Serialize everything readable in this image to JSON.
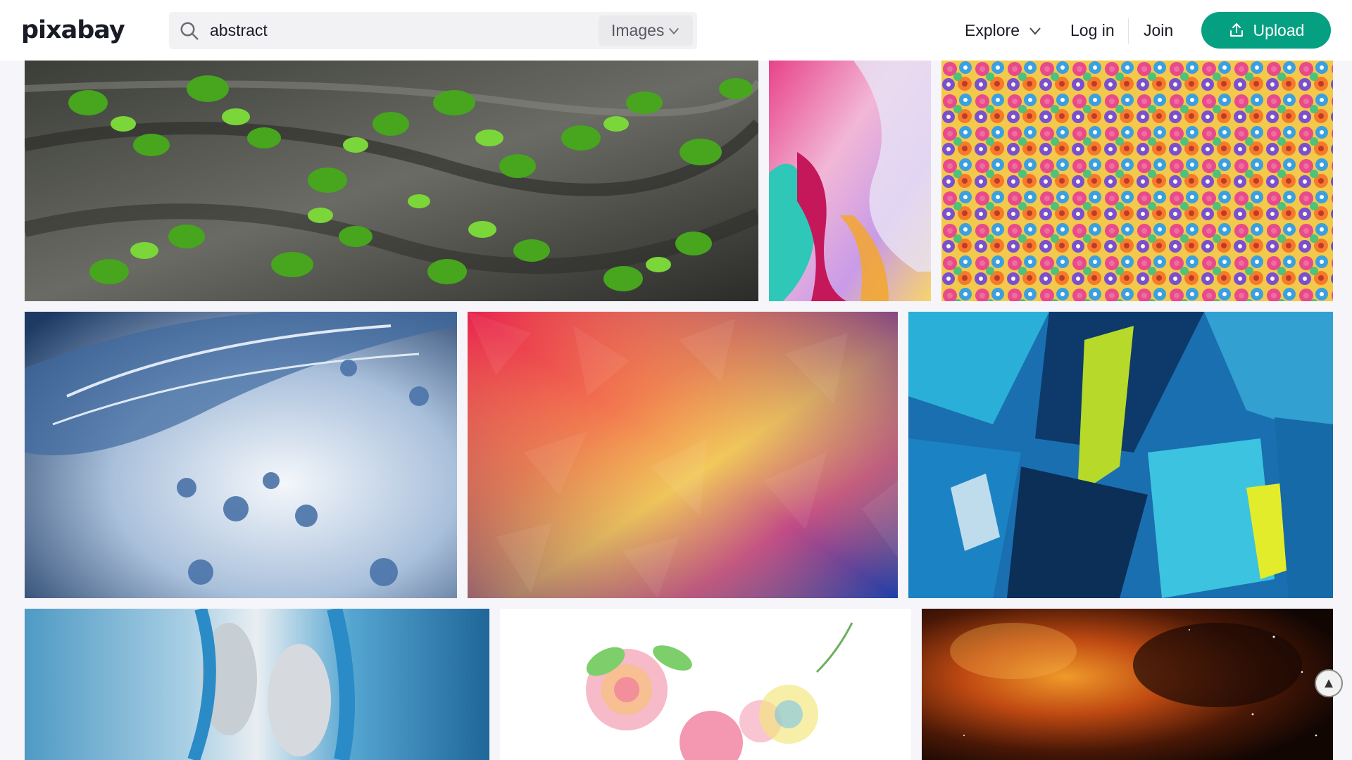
{
  "header": {
    "logo_text": "pixabay",
    "search": {
      "value": "abstract",
      "placeholder": "Search"
    },
    "search_type": "Images",
    "nav": {
      "explore": "Explore",
      "login": "Log in",
      "join": "Join",
      "upload": "Upload"
    }
  },
  "colors": {
    "brand_green": "#05a081",
    "header_bg": "#ffffff",
    "page_bg": "#f5f5fa"
  },
  "gallery": {
    "rows": [
      {
        "items": [
          {
            "subject": "green ivy leaves on tree bark"
          },
          {
            "subject": "pink and turquoise alcohol ink"
          },
          {
            "subject": "colorful flower pattern"
          }
        ]
      },
      {
        "items": [
          {
            "subject": "water splash"
          },
          {
            "subject": "colorful low-poly gradient"
          },
          {
            "subject": "blue and green abstract painting"
          }
        ]
      },
      {
        "items": [
          {
            "subject": "blue water couple"
          },
          {
            "subject": "watercolor flowers"
          },
          {
            "subject": "orange space nebula"
          }
        ]
      }
    ]
  },
  "scroll_top_icon": "arrow-up-icon"
}
